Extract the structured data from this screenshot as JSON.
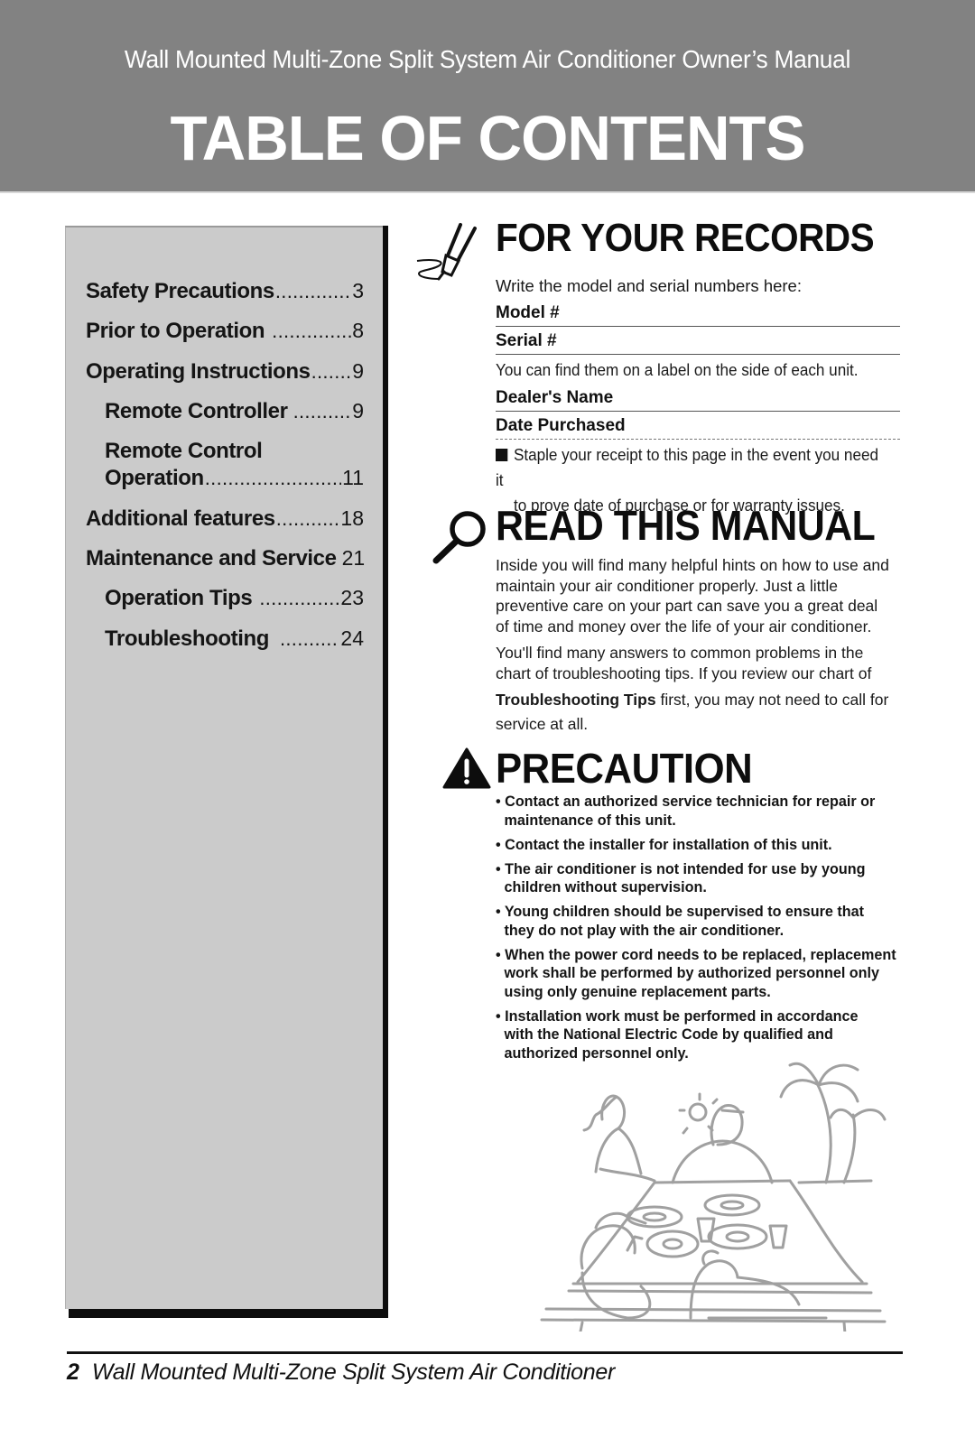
{
  "header": {
    "subtitle": "Wall Mounted Multi-Zone Split System Air Conditioner Owner’s Manual",
    "title": "TABLE OF CONTENTS",
    "background_color": "#828282"
  },
  "toc": {
    "items": [
      {
        "label": "Safety Precautions",
        "page": "3",
        "level": 1
      },
      {
        "label": "Prior to Operation",
        "page": "8",
        "level": 1
      },
      {
        "label": "Operating Instructions",
        "page": "9",
        "level": 1
      },
      {
        "label": "Remote Controller",
        "page": "9",
        "level": 2
      },
      {
        "label": "Remote Control",
        "label_line2": "Operation",
        "page": "11",
        "level": 2
      },
      {
        "label": "Additional features",
        "page": "18",
        "level": 1
      },
      {
        "label": "Maintenance and Service",
        "page": "21",
        "level": 1
      },
      {
        "label": "Operation Tips",
        "page": "23",
        "level": 2
      },
      {
        "label": "Troubleshooting",
        "page": "24",
        "level": 2
      }
    ]
  },
  "records": {
    "icon": "pen-icon",
    "heading": "FOR YOUR RECORDS",
    "intro": "Write the model and serial numbers here:",
    "fields": [
      {
        "label": "Model #",
        "value": ""
      },
      {
        "label": "Serial #",
        "value": ""
      }
    ],
    "label_note": "You can find them on a label on the side of each unit.",
    "fields2": [
      {
        "label": "Dealer's Name",
        "value": ""
      },
      {
        "label": "Date Purchased",
        "value": ""
      }
    ],
    "staple_line1": "Staple your receipt to this page in the event you need it",
    "staple_line2": "to prove date of purchase or for warranty issues."
  },
  "read_manual": {
    "icon": "magnifier-icon",
    "heading": "READ THIS MANUAL",
    "para1_lines": [
      "Inside you will find many helpful hints on how to use and",
      "maintain your air conditioner properly. Just a little",
      "preventive care on your part can save you a great deal",
      "of time and money over the life of your air conditioner."
    ],
    "para2_lines": [
      "You'll find many answers to common problems in the",
      "chart of troubleshooting tips. If you review our chart of"
    ],
    "para2_bold": "Troubleshooting Tips",
    "para2_rest": " first, you may not need to call for",
    "para2_last": "service at all."
  },
  "precaution": {
    "icon": "warning-icon",
    "heading": "PRECAUTION",
    "items": [
      "Contact an authorized service technician for repair or maintenance of this unit.",
      "Contact the installer for installation of this unit.",
      "The air conditioner is not intended for use by young children without supervision.",
      "Young children should be supervised to ensure that they do not play with the air conditioner.",
      "When the power cord needs to be replaced, replacement work shall be performed by authorized personnel only using only genuine replacement parts.",
      "Installation work must be performed in accordance with the National Electric Code by qualified and authorized personnel only."
    ]
  },
  "illustration": {
    "name": "family-picnic-illustration"
  },
  "footer": {
    "page_number": "2",
    "text": "Wall Mounted Multi-Zone Split System Air Conditioner"
  }
}
